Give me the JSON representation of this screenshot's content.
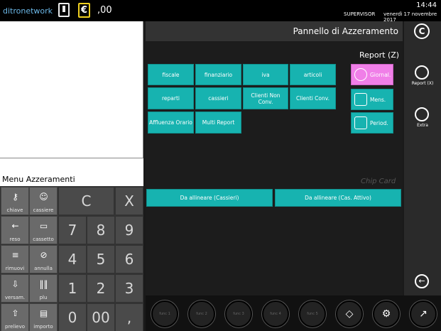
{
  "header": {
    "logo_text": "ditronetwork",
    "cash_value": ",00",
    "time": "14:44",
    "user": "SUPERVISOR",
    "date": "venerdì 17 novembre 2017"
  },
  "left": {
    "menu_title": "Menu Azzeramenti",
    "function_keys": [
      "chiave",
      "cassiere",
      "reso",
      "cassetto",
      "rimuovi",
      "annulla",
      "versam.",
      "plu",
      "prelievo",
      "importo"
    ],
    "numeric_keys": [
      "C",
      "X",
      "7",
      "8",
      "9",
      "4",
      "5",
      "6",
      "1",
      "2",
      "3",
      "0",
      "00",
      ","
    ]
  },
  "main": {
    "title": "Pannello di  Azzeramento",
    "report_z_label": "Report (Z)",
    "grid_buttons": [
      "fiscale",
      "finanziario",
      "iva",
      "articoli",
      "reparti",
      "cassieri",
      "Clienti Non Conv.",
      "Clienti Conv.",
      "Affluenza Orario",
      "Multi Report"
    ],
    "side_buttons": [
      "Giornal.",
      "Mens.",
      "Period."
    ],
    "chip_card": "Chip Card",
    "align_buttons": [
      "Da allineare (Cassieri)",
      "Da allineare (Cas. Attivo)"
    ]
  },
  "rail": {
    "report_x_label": "Report (X)",
    "extra_label": "Extra"
  },
  "bottom": {
    "func_buttons": [
      "func 1",
      "func 2",
      "func 3",
      "func 4",
      "func 5"
    ]
  }
}
